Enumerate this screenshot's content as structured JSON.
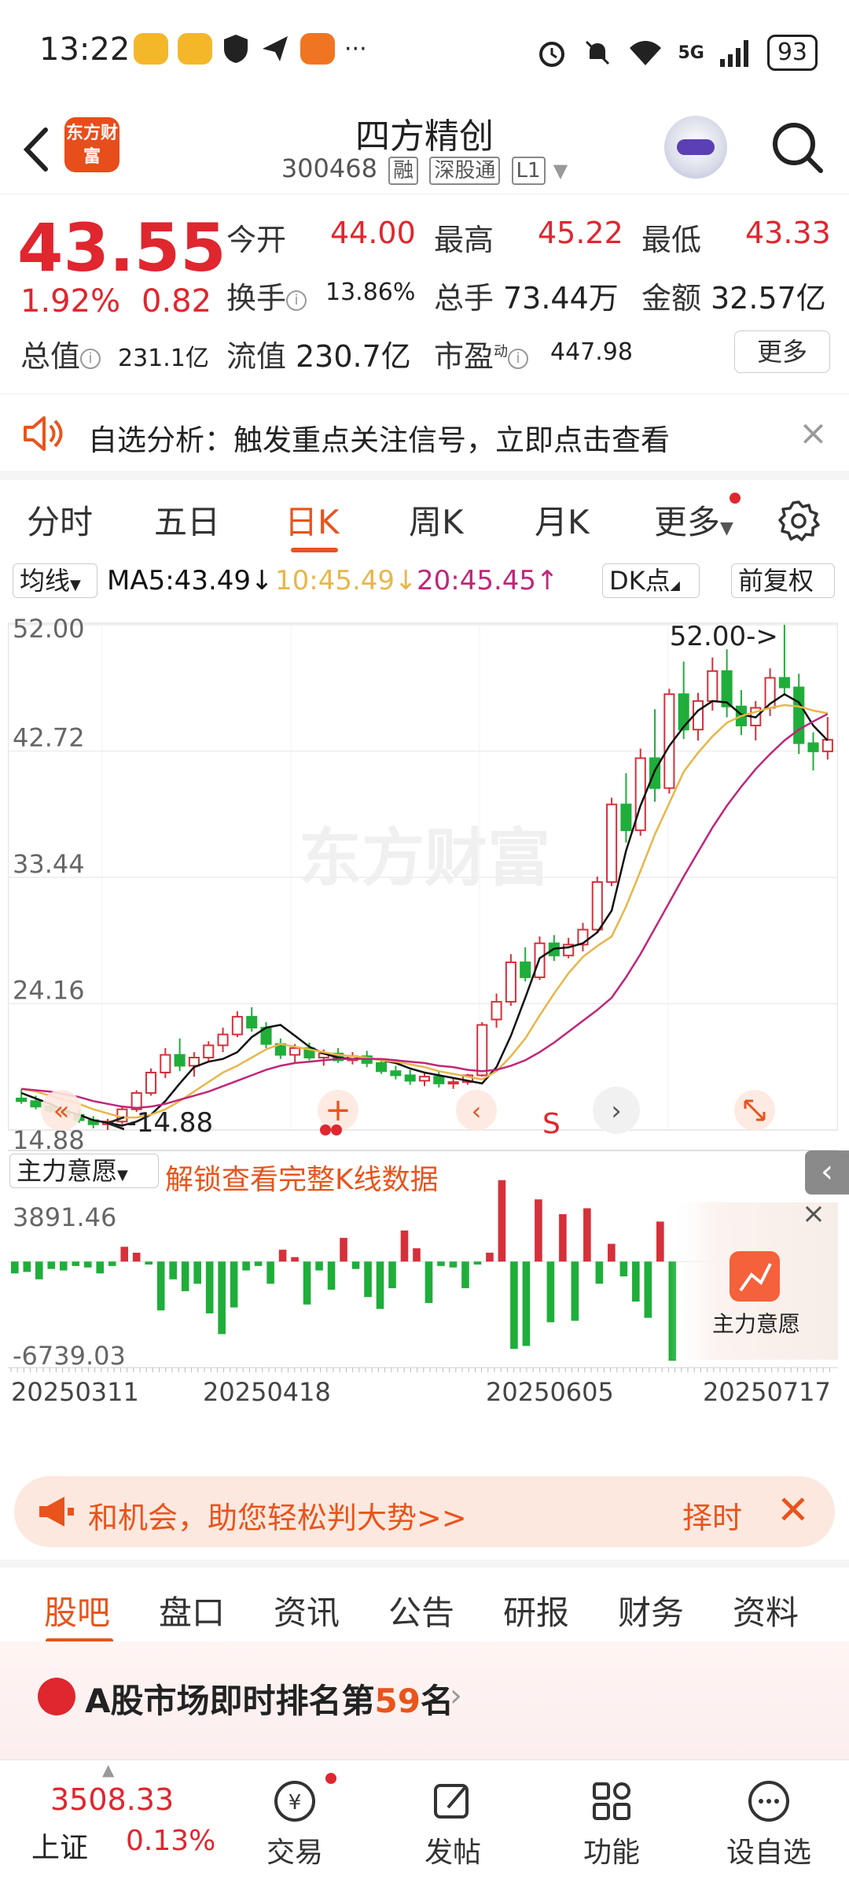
{
  "status_bar": {
    "time": "13:22",
    "battery": "93",
    "network": "5G"
  },
  "header": {
    "logo_text": "东方财富",
    "title": "四方精创",
    "code": "300468",
    "tags": [
      "融",
      "深股通",
      "L1"
    ]
  },
  "quote": {
    "price": "43.55",
    "change_pct": "1.92%",
    "change": "0.82",
    "open_label": "今开",
    "open": "44.00",
    "high_label": "最高",
    "high": "45.22",
    "low_label": "最低",
    "low": "43.33",
    "turnover_label": "换手",
    "turnover": "13.86%",
    "volume_label": "总手",
    "volume": "73.44万",
    "amount_label": "金额",
    "amount": "32.57亿",
    "mktcap_label": "总值",
    "mktcap": "231.1亿",
    "float_label": "流值",
    "float": "230.7亿",
    "pe_label": "市盈",
    "pe_sup": "动",
    "pe": "447.98",
    "more": "更多"
  },
  "notice": {
    "text": "自选分析：触发重点关注信号，立即点击查看",
    "close": "×"
  },
  "tabs": {
    "items": [
      "分时",
      "五日",
      "日K",
      "周K",
      "月K",
      "更多"
    ],
    "active": "日K"
  },
  "ma_row": {
    "selector": "均线",
    "ma5": "MA5:43.49↓",
    "ma10": "10:45.49↓",
    "ma20": "20:45.45↑",
    "dk": "DK点",
    "adjust": "前复权",
    "colors": {
      "ma5": "#111111",
      "ma10": "#e8b64a",
      "ma20": "#c0267a",
      "up": "#d6303a",
      "down": "#1fae3a"
    }
  },
  "chart_data": [
    {
      "type": "candlestick",
      "y_ticks": [
        "52.00",
        "42.72",
        "33.44",
        "24.16",
        "14.88"
      ],
      "ylim": [
        14.88,
        52.0
      ],
      "annotations": [
        "52.00->",
        "<-14.88"
      ],
      "watermark": "东方财富",
      "signal_marker": "S",
      "series": [
        {
          "name": "MA5",
          "values": [
            17.6,
            17.2,
            16.8,
            16.3,
            16.0,
            15.6,
            15.4,
            15.2,
            15.5,
            16.0,
            17.0,
            18.3,
            19.5,
            19.9,
            20.1,
            20.6,
            21.7,
            22.4,
            22.6,
            21.8,
            21.0,
            20.5,
            20.2,
            20.1,
            20.2,
            20.0,
            19.8,
            19.4,
            19.1,
            18.9,
            18.7,
            18.5,
            18.3,
            19.5,
            21.8,
            24.6,
            27.5,
            28.2,
            28.3,
            28.6,
            29.4,
            31.0,
            35.4,
            38.7,
            41.3,
            43.1,
            44.5,
            45.7,
            46.4,
            46.3,
            45.4,
            45.2,
            46.2,
            46.9,
            46.3,
            44.6,
            43.5
          ]
        },
        {
          "name": "MA10",
          "values": [
            17.9,
            17.7,
            17.4,
            17.1,
            16.8,
            16.4,
            16.1,
            15.8,
            15.8,
            16.0,
            16.4,
            17.0,
            17.7,
            18.4,
            19.1,
            19.6,
            20.2,
            20.8,
            21.2,
            21.0,
            20.8,
            20.6,
            20.4,
            20.3,
            20.2,
            20.0,
            19.9,
            19.7,
            19.5,
            19.2,
            19.0,
            18.8,
            18.6,
            19.2,
            20.3,
            21.6,
            23.3,
            24.9,
            26.4,
            27.6,
            28.4,
            29.1,
            31.3,
            33.9,
            36.6,
            38.9,
            41.2,
            42.6,
            43.8,
            44.8,
            45.3,
            45.6,
            45.9,
            46.1,
            46.0,
            45.7,
            45.5
          ]
        },
        {
          "name": "MA20",
          "values": [
            17.9,
            17.8,
            17.7,
            17.5,
            17.3,
            17.0,
            16.8,
            16.6,
            16.5,
            16.6,
            16.8,
            17.1,
            17.4,
            17.7,
            18.1,
            18.5,
            18.9,
            19.3,
            19.6,
            19.8,
            19.9,
            20.0,
            20.1,
            20.1,
            20.1,
            20.1,
            20.0,
            19.9,
            19.8,
            19.6,
            19.5,
            19.3,
            19.2,
            19.3,
            19.6,
            20.0,
            20.6,
            21.3,
            22.1,
            22.9,
            23.7,
            24.6,
            26.1,
            27.8,
            29.7,
            31.6,
            33.5,
            35.3,
            37.1,
            38.7,
            40.1,
            41.4,
            42.5,
            43.5,
            44.3,
            44.9,
            45.45
          ]
        }
      ],
      "candles": [
        {
          "o": 17.2,
          "h": 17.9,
          "l": 16.8,
          "c": 17.0
        },
        {
          "o": 17.0,
          "h": 17.4,
          "l": 16.4,
          "c": 16.6
        },
        {
          "o": 16.6,
          "h": 16.9,
          "l": 16.1,
          "c": 16.3
        },
        {
          "o": 16.3,
          "h": 16.6,
          "l": 15.8,
          "c": 16.0
        },
        {
          "o": 16.0,
          "h": 16.4,
          "l": 15.4,
          "c": 15.6
        },
        {
          "o": 15.6,
          "h": 15.9,
          "l": 15.0,
          "c": 15.3
        },
        {
          "o": 15.3,
          "h": 15.7,
          "l": 14.88,
          "c": 15.5
        },
        {
          "o": 15.5,
          "h": 16.6,
          "l": 15.3,
          "c": 16.4
        },
        {
          "o": 16.4,
          "h": 17.8,
          "l": 16.2,
          "c": 17.6
        },
        {
          "o": 17.6,
          "h": 19.4,
          "l": 17.4,
          "c": 19.1
        },
        {
          "o": 19.1,
          "h": 20.9,
          "l": 18.7,
          "c": 20.4
        },
        {
          "o": 20.4,
          "h": 21.6,
          "l": 19.2,
          "c": 19.6
        },
        {
          "o": 19.6,
          "h": 20.6,
          "l": 18.8,
          "c": 20.2
        },
        {
          "o": 20.2,
          "h": 21.4,
          "l": 19.9,
          "c": 21.1
        },
        {
          "o": 21.1,
          "h": 22.4,
          "l": 20.6,
          "c": 21.9
        },
        {
          "o": 21.9,
          "h": 23.6,
          "l": 21.7,
          "c": 23.2
        },
        {
          "o": 23.2,
          "h": 23.9,
          "l": 22.1,
          "c": 22.4
        },
        {
          "o": 22.4,
          "h": 22.8,
          "l": 20.9,
          "c": 21.2
        },
        {
          "o": 21.2,
          "h": 21.6,
          "l": 20.1,
          "c": 20.4
        },
        {
          "o": 20.4,
          "h": 21.2,
          "l": 19.8,
          "c": 20.9
        },
        {
          "o": 20.9,
          "h": 21.3,
          "l": 20.0,
          "c": 20.2
        },
        {
          "o": 20.2,
          "h": 20.8,
          "l": 19.6,
          "c": 20.5
        },
        {
          "o": 20.5,
          "h": 20.9,
          "l": 19.8,
          "c": 20.0
        },
        {
          "o": 20.0,
          "h": 20.6,
          "l": 19.7,
          "c": 20.3
        },
        {
          "o": 20.3,
          "h": 20.7,
          "l": 19.5,
          "c": 19.8
        },
        {
          "o": 19.8,
          "h": 20.1,
          "l": 19.0,
          "c": 19.2
        },
        {
          "o": 19.2,
          "h": 19.6,
          "l": 18.6,
          "c": 18.9
        },
        {
          "o": 18.9,
          "h": 19.3,
          "l": 18.2,
          "c": 18.5
        },
        {
          "o": 18.5,
          "h": 19.1,
          "l": 18.1,
          "c": 18.8
        },
        {
          "o": 18.8,
          "h": 19.2,
          "l": 18.0,
          "c": 18.3
        },
        {
          "o": 18.3,
          "h": 18.7,
          "l": 17.9,
          "c": 18.4
        },
        {
          "o": 18.4,
          "h": 19.0,
          "l": 18.2,
          "c": 18.9
        },
        {
          "o": 18.9,
          "h": 22.8,
          "l": 18.8,
          "c": 22.6
        },
        {
          "o": 23.0,
          "h": 24.9,
          "l": 22.4,
          "c": 24.3
        },
        {
          "o": 24.3,
          "h": 27.8,
          "l": 24.0,
          "c": 27.2
        },
        {
          "o": 27.2,
          "h": 28.3,
          "l": 25.8,
          "c": 26.1
        },
        {
          "o": 26.1,
          "h": 29.1,
          "l": 25.9,
          "c": 28.6
        },
        {
          "o": 28.6,
          "h": 29.2,
          "l": 27.3,
          "c": 27.7
        },
        {
          "o": 27.7,
          "h": 29.0,
          "l": 27.5,
          "c": 28.5
        },
        {
          "o": 28.5,
          "h": 30.1,
          "l": 28.0,
          "c": 29.6
        },
        {
          "o": 29.6,
          "h": 33.5,
          "l": 29.4,
          "c": 33.1
        },
        {
          "o": 33.1,
          "h": 39.3,
          "l": 32.8,
          "c": 38.8
        },
        {
          "o": 38.8,
          "h": 41.1,
          "l": 36.0,
          "c": 36.9
        },
        {
          "o": 36.9,
          "h": 42.9,
          "l": 36.5,
          "c": 42.2
        },
        {
          "o": 42.2,
          "h": 45.8,
          "l": 39.0,
          "c": 40.0
        },
        {
          "o": 40.0,
          "h": 47.3,
          "l": 39.6,
          "c": 46.9
        },
        {
          "o": 46.9,
          "h": 49.3,
          "l": 43.6,
          "c": 44.3
        },
        {
          "o": 44.3,
          "h": 47.0,
          "l": 43.5,
          "c": 46.4
        },
        {
          "o": 46.4,
          "h": 49.6,
          "l": 45.7,
          "c": 48.6
        },
        {
          "o": 48.6,
          "h": 50.2,
          "l": 45.2,
          "c": 46.0
        },
        {
          "o": 46.0,
          "h": 47.2,
          "l": 43.9,
          "c": 44.6
        },
        {
          "o": 44.6,
          "h": 46.4,
          "l": 43.5,
          "c": 45.9
        },
        {
          "o": 45.9,
          "h": 48.8,
          "l": 45.3,
          "c": 48.1
        },
        {
          "o": 48.1,
          "h": 52.0,
          "l": 46.8,
          "c": 47.4
        },
        {
          "o": 47.4,
          "h": 48.4,
          "l": 42.5,
          "c": 43.3
        },
        {
          "o": 43.3,
          "h": 44.1,
          "l": 41.3,
          "c": 42.7
        },
        {
          "o": 42.7,
          "h": 45.22,
          "l": 42.1,
          "c": 43.55
        }
      ]
    },
    {
      "type": "bar",
      "name": "主力意愿",
      "y_ticks": [
        "3891.46",
        "-6739.03"
      ],
      "ylim": [
        -6739.03,
        3891.46
      ],
      "x_ticks": [
        "20250311",
        "20250418",
        "20250605",
        "20250717"
      ],
      "values": [
        -800,
        -700,
        -1200,
        -500,
        -600,
        -300,
        -400,
        -800,
        -300,
        1000,
        600,
        -200,
        -3300,
        -1200,
        -2000,
        -1500,
        -3500,
        -4900,
        -3100,
        -600,
        -300,
        -1500,
        800,
        300,
        -2900,
        -600,
        -1900,
        1600,
        -500,
        -2400,
        -3200,
        -1800,
        2100,
        900,
        -2800,
        -300,
        -400,
        -1800,
        -200,
        600,
        5500,
        -5900,
        -5700,
        4200,
        -4100,
        3200,
        -4000,
        3600,
        -1500,
        1200,
        -1000,
        -2700,
        -3800,
        2700,
        -6700
      ]
    }
  ],
  "indicator_panel": {
    "selector": "主力意愿",
    "unlock_text": "解锁查看完整K线数据",
    "badge_label": "主力意愿",
    "close": "×"
  },
  "ad_bar": {
    "text": "和机会，助您轻松判大势>>",
    "right_text": "择时",
    "close": "✕"
  },
  "section_tabs": {
    "items": [
      "股吧",
      "盘口",
      "资讯",
      "公告",
      "研报",
      "财务",
      "资料"
    ],
    "active": "股吧"
  },
  "rank": {
    "prefix": "A股市场即时排名第",
    "num": "59",
    "suffix": "名",
    "chevron": "›"
  },
  "bottom_nav": {
    "index_value": "3508.33",
    "index_name": "上证",
    "index_pct": "0.13%",
    "items": [
      "交易",
      "发帖",
      "功能",
      "设自选"
    ]
  }
}
